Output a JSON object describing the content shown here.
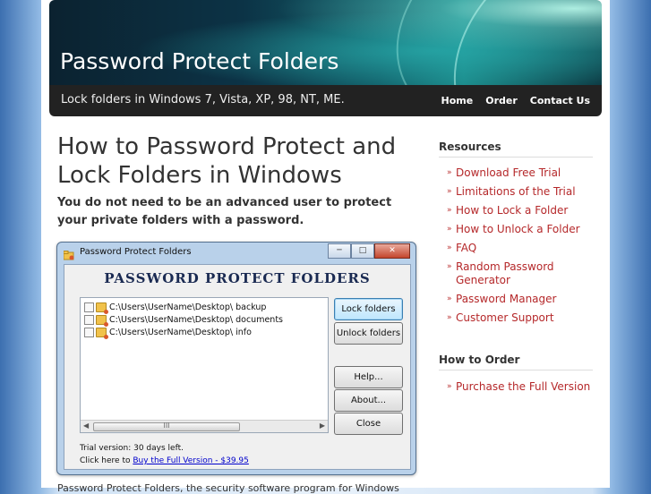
{
  "site": {
    "title": "Password Protect Folders",
    "tagline": "Lock folders in Windows 7, Vista, XP, 98, NT, ME."
  },
  "nav": [
    {
      "label": "Home"
    },
    {
      "label": "Order"
    },
    {
      "label": "Contact Us"
    }
  ],
  "main": {
    "heading": "How to Password Protect and Lock Folders in Windows",
    "intro": "You do not need to be an advanced user to protect your private folders with a password.",
    "cut_text": "Password Protect Folders, the security software program for Windows"
  },
  "app_window": {
    "title": "Password Protect Folders",
    "banner": "PASSWORD PROTECT FOLDERS",
    "controls": {
      "minimize": "─",
      "maximize": "□",
      "close": "✕"
    },
    "folders": [
      {
        "path": "C:\\Users\\UserName\\Desktop\\ backup"
      },
      {
        "path": "C:\\Users\\UserName\\Desktop\\ documents"
      },
      {
        "path": "C:\\Users\\UserName\\Desktop\\ info"
      }
    ],
    "scroll_left": "◀",
    "scroll_grip": "III",
    "scroll_right": "▶",
    "buttons": {
      "lock": "Lock folders",
      "unlock": "Unlock folders",
      "help": "Help...",
      "about": "About...",
      "close": "Close"
    },
    "trial_text": "Trial version: 30 days left.",
    "buy_prefix": "Click here to",
    "buy_link": "Buy the Full Version - $39.95"
  },
  "sidebar": {
    "resources_heading": "Resources",
    "resources": [
      {
        "label": "Download Free Trial"
      },
      {
        "label": "Limitations of the Trial"
      },
      {
        "label": "How to Lock a Folder"
      },
      {
        "label": "How to Unlock a Folder"
      },
      {
        "label": "FAQ"
      },
      {
        "label": "Random Password Generator"
      },
      {
        "label": "Password Manager"
      },
      {
        "label": "Customer Support"
      }
    ],
    "order_heading": "How to Order",
    "order_links": [
      {
        "label": "Purchase the Full Version"
      }
    ]
  },
  "colors": {
    "link": "#b5282a",
    "navbar": "#222222",
    "heading_text": "#333333"
  }
}
